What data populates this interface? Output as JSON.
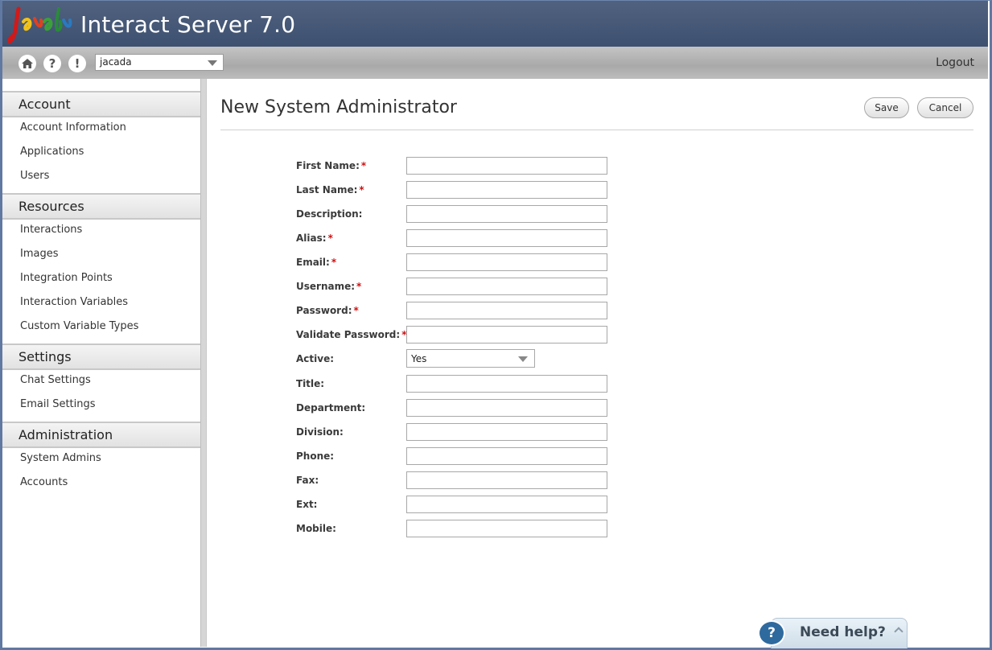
{
  "header": {
    "logo_text": "jacada",
    "app_title": "Interact Server 7.0"
  },
  "toolbar": {
    "home_icon": "home-icon",
    "help_icon": "question-icon",
    "alert_icon": "exclamation-icon",
    "account_select_value": "jacada",
    "logout_label": "Logout"
  },
  "sidebar": {
    "sections": [
      {
        "title": "Account",
        "items": [
          "Account Information",
          "Applications",
          "Users"
        ]
      },
      {
        "title": "Resources",
        "items": [
          "Interactions",
          "Images",
          "Integration Points",
          "Interaction Variables",
          "Custom Variable Types"
        ]
      },
      {
        "title": "Settings",
        "items": [
          "Chat Settings",
          "Email Settings"
        ]
      },
      {
        "title": "Administration",
        "items": [
          "System Admins",
          "Accounts"
        ]
      }
    ]
  },
  "main": {
    "page_title": "New System Administrator",
    "save_label": "Save",
    "cancel_label": "Cancel",
    "fields": [
      {
        "label": "First Name:",
        "required": true,
        "value": ""
      },
      {
        "label": "Last Name:",
        "required": true,
        "value": ""
      },
      {
        "label": "Description:",
        "required": false,
        "value": ""
      },
      {
        "label": "Alias:",
        "required": true,
        "value": ""
      },
      {
        "label": "Email:",
        "required": true,
        "value": ""
      },
      {
        "label": "Username:",
        "required": true,
        "value": ""
      },
      {
        "label": "Password:",
        "required": true,
        "value": ""
      },
      {
        "label": "Validate Password:",
        "required": true,
        "value": ""
      },
      {
        "label": "Active:",
        "required": false,
        "value": "Yes",
        "type": "select"
      },
      {
        "label": "Title:",
        "required": false,
        "value": ""
      },
      {
        "label": "Department:",
        "required": false,
        "value": ""
      },
      {
        "label": "Division:",
        "required": false,
        "value": ""
      },
      {
        "label": "Phone:",
        "required": false,
        "value": ""
      },
      {
        "label": "Fax:",
        "required": false,
        "value": ""
      },
      {
        "label": "Ext:",
        "required": false,
        "value": ""
      },
      {
        "label": "Mobile:",
        "required": false,
        "value": ""
      }
    ],
    "required_marker": "*"
  },
  "help_widget": {
    "label": "Need help?",
    "icon": "question-bubble-icon"
  },
  "colors": {
    "header_bg": "#44577a",
    "required": "#cc1111",
    "help_icon_bg": "#2f6a9e"
  }
}
